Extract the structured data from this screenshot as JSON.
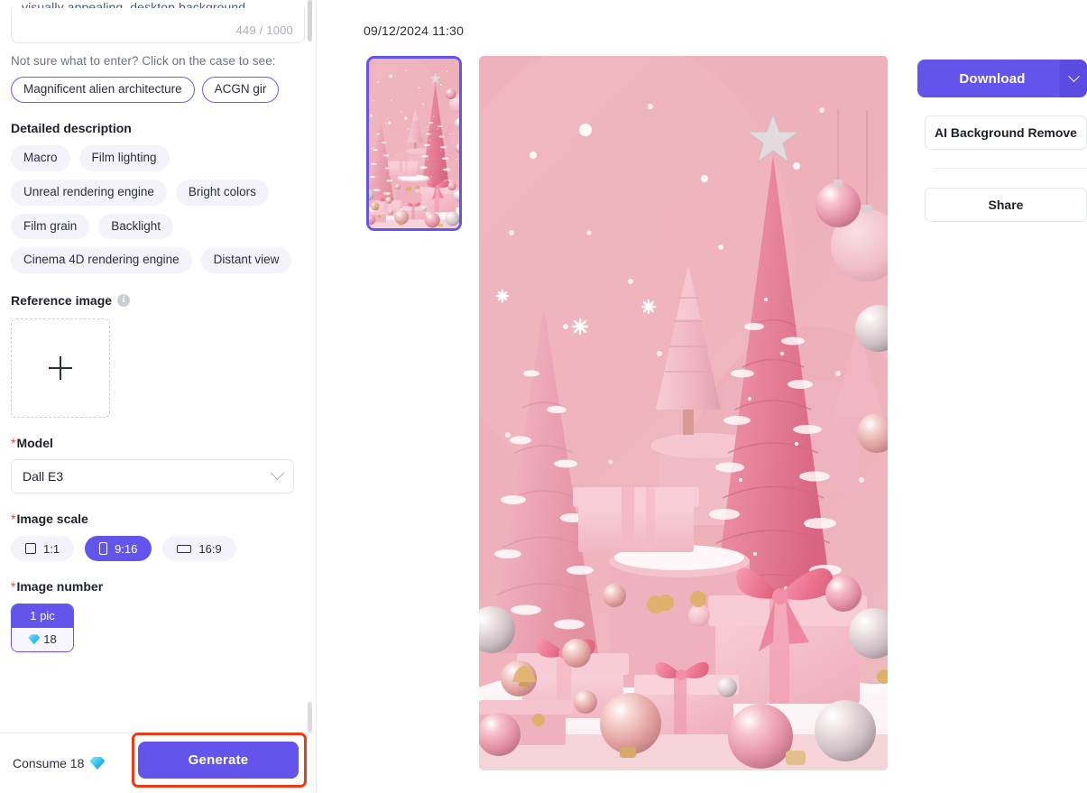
{
  "sidebar": {
    "prompt": {
      "tail_text": "visually appealing, desktop background.",
      "char_count": "449 / 1000"
    },
    "hint": "Not sure what to enter? Click on the case to see:",
    "case_chips": [
      {
        "label": "Magnificent alien architecture"
      },
      {
        "label": "ACGN gir"
      }
    ],
    "detailed_description": {
      "label": "Detailed description",
      "tags": [
        "Macro",
        "Film lighting",
        "Unreal rendering engine",
        "Bright colors",
        "Film grain",
        "Backlight",
        "Cinema 4D rendering engine",
        "Distant view"
      ]
    },
    "reference_image": {
      "label": "Reference image",
      "info_icon": "info-icon",
      "upload_icon": "plus-icon"
    },
    "model": {
      "label": "Model",
      "required": true,
      "value": "Dall E3",
      "chevron_icon": "chevron-down-icon"
    },
    "image_scale": {
      "label": "Image scale",
      "required": true,
      "options": [
        {
          "label": "1:1",
          "selected": false,
          "icon": "square-icon"
        },
        {
          "label": "9:16",
          "selected": true,
          "icon": "portrait-icon"
        },
        {
          "label": "16:9",
          "selected": false,
          "icon": "landscape-icon"
        }
      ]
    },
    "image_number": {
      "label": "Image number",
      "required": true,
      "options": [
        {
          "label": "1 pic",
          "cost": "18",
          "cost_icon": "gem-icon",
          "selected": true
        }
      ]
    },
    "footer": {
      "consume_label": "Consume 18",
      "consume_icon": "gem-icon",
      "generate_label": "Generate",
      "annotation_color": "#f03a17"
    }
  },
  "main": {
    "timestamp": "09/12/2024 11:30",
    "thumbnail": {
      "name": "result-thumbnail-1",
      "selected": true
    },
    "hero_image": {
      "name": "generated-image-preview"
    }
  },
  "right_panel": {
    "download_label": "Download",
    "download_chevron_icon": "chevron-down-icon",
    "background_remove_label": "AI Background Remove",
    "share_label": "Share"
  },
  "colors": {
    "accent": "#6355ec",
    "accent_dark": "#5a4ce0",
    "required_star": "#f53f3f",
    "annotation_red": "#f03a17",
    "chip_bg": "#f4f3fb",
    "art_bg": "#eeb1b9",
    "art_tree_deep": "#e8839a",
    "art_tree_light": "#f2b9c6"
  }
}
